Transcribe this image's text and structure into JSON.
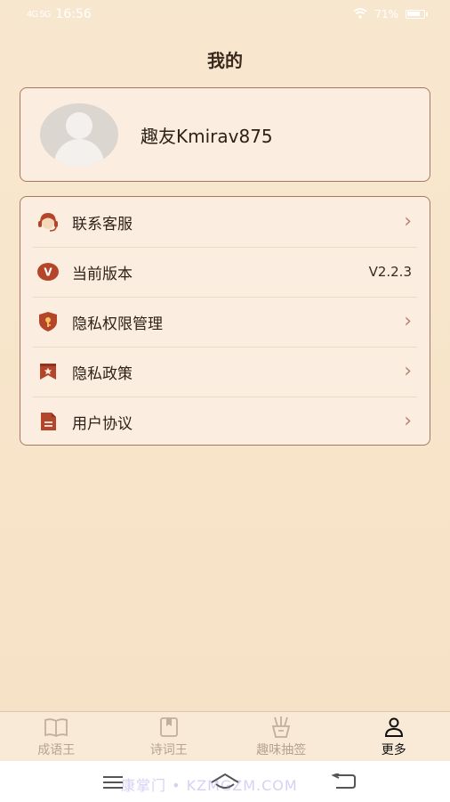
{
  "status_bar": {
    "time": "16:56",
    "signal_left": "4G  5G",
    "battery_pct": "71%"
  },
  "page": {
    "title": "我的"
  },
  "profile": {
    "username": "趣友Kmirav875"
  },
  "menu": [
    {
      "label": "联系客服",
      "icon": "customer-service-icon",
      "arrow": "›"
    },
    {
      "label": "当前版本",
      "icon": "version-icon",
      "value": "V2.2.3",
      "badge": "V"
    },
    {
      "label": "隐私权限管理",
      "icon": "shield-key-icon",
      "arrow": "›"
    },
    {
      "label": "隐私政策",
      "icon": "bookmark-star-icon",
      "arrow": "›"
    },
    {
      "label": "用户协议",
      "icon": "document-icon",
      "arrow": "›"
    }
  ],
  "tabs": [
    {
      "label": "成语王",
      "icon": "book-icon",
      "active": false
    },
    {
      "label": "诗词王",
      "icon": "bookmark-book-icon",
      "active": false
    },
    {
      "label": "趣味抽签",
      "icon": "fortune-sticks-icon",
      "active": false
    },
    {
      "label": "更多",
      "icon": "user-icon",
      "active": true
    }
  ],
  "watermark": "康掌门 • KZMGZM.COM",
  "colors": {
    "accent": "#b5452a",
    "border": "#a9785c",
    "card_bg": "#fbeee0",
    "bg": "#f8e7cf"
  }
}
